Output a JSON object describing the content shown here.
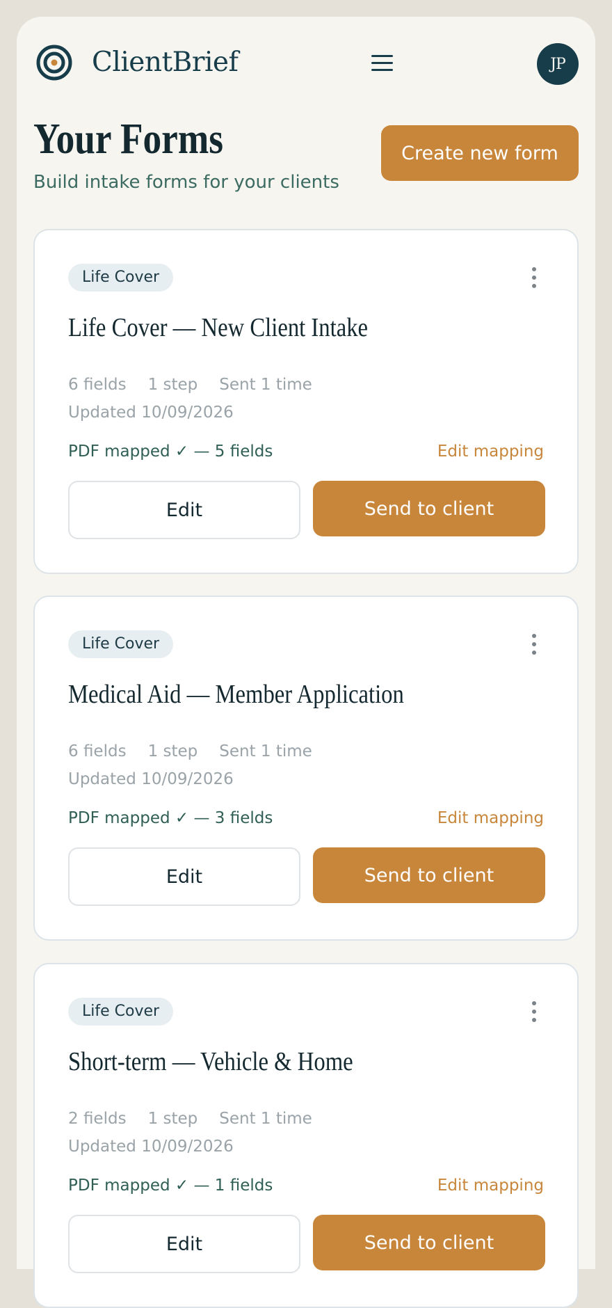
{
  "app": {
    "brand": "ClientBrief",
    "avatar_initials": "JP"
  },
  "header": {
    "title": "Your Forms",
    "subtitle": "Build intake forms for your clients",
    "create_button": "Create new form"
  },
  "colors": {
    "accent": "#c8863b",
    "brand_dark": "#173d4b",
    "mapped_text": "#2f5f55"
  },
  "forms": [
    {
      "badge": "Life Cover",
      "title": "Life Cover — New Client Intake",
      "fields": "6 fields",
      "steps": "1 step",
      "sent": "Sent 1 time",
      "updated": "Updated 10/09/2026",
      "mapped": "PDF mapped ✓ — 5 fields",
      "edit_mapping": "Edit mapping",
      "edit_label": "Edit",
      "send_label": "Send to client"
    },
    {
      "badge": "Life Cover",
      "title": "Medical Aid — Member Application",
      "fields": "6 fields",
      "steps": "1 step",
      "sent": "Sent 1 time",
      "updated": "Updated 10/09/2026",
      "mapped": "PDF mapped ✓ — 3 fields",
      "edit_mapping": "Edit mapping",
      "edit_label": "Edit",
      "send_label": "Send to client"
    },
    {
      "badge": "Life Cover",
      "title": "Short-term — Vehicle & Home",
      "fields": "2 fields",
      "steps": "1 step",
      "sent": "Sent 1 time",
      "updated": "Updated 10/09/2026",
      "mapped": "PDF mapped ✓ — 1 fields",
      "edit_mapping": "Edit mapping",
      "edit_label": "Edit",
      "send_label": "Send to client"
    }
  ]
}
